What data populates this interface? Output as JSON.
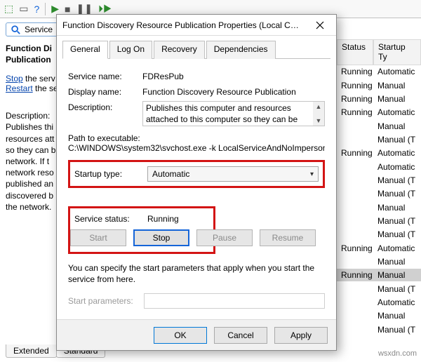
{
  "bg": {
    "search_placeholder": "Service",
    "left": {
      "title_line1": "Function Di",
      "title_line2": "Publication",
      "stop_link": "Stop",
      "stop_tail": " the serv",
      "restart_link": "Restart",
      "restart_tail": " the se",
      "desc_label": "Description:",
      "desc_body": "Publishes thi resources att so they can b network.  If t network reso published an discovered b the network."
    },
    "cols": {
      "status_hdr": "Status",
      "startup_hdr": "Startup Ty"
    },
    "rows": [
      {
        "status": "Running",
        "startup": "Automatic"
      },
      {
        "status": "Running",
        "startup": "Manual"
      },
      {
        "status": "Running",
        "startup": "Manual"
      },
      {
        "status": "Running",
        "startup": "Automatic"
      },
      {
        "status": "",
        "startup": "Manual"
      },
      {
        "status": "",
        "startup": "Manual (T"
      },
      {
        "status": "Running",
        "startup": "Automatic"
      },
      {
        "status": "",
        "startup": "Automatic"
      },
      {
        "status": "",
        "startup": "Manual (T"
      },
      {
        "status": "",
        "startup": "Manual (T"
      },
      {
        "status": "",
        "startup": "Manual"
      },
      {
        "status": "",
        "startup": "Manual (T"
      },
      {
        "status": "",
        "startup": "Manual (T"
      },
      {
        "status": "Running",
        "startup": "Automatic"
      },
      {
        "status": "",
        "startup": "Manual"
      },
      {
        "status": "Running",
        "startup": "Manual",
        "selected": true
      },
      {
        "status": "",
        "startup": "Manual (T"
      },
      {
        "status": "",
        "startup": "Automatic"
      },
      {
        "status": "",
        "startup": "Manual"
      },
      {
        "status": "",
        "startup": "Manual (T"
      }
    ],
    "tab_extended": "Extended",
    "tab_standard": "Standard"
  },
  "dialog": {
    "title": "Function Discovery Resource Publication Properties (Local Comput...",
    "tabs": {
      "general": "General",
      "logon": "Log On",
      "recovery": "Recovery",
      "dependencies": "Dependencies"
    },
    "service_name_lbl": "Service name:",
    "service_name": "FDResPub",
    "display_name_lbl": "Display name:",
    "display_name": "Function Discovery Resource Publication",
    "description_lbl": "Description:",
    "description": "Publishes this computer and resources attached to this computer so they can be discovered over the",
    "path_lbl": "Path to executable:",
    "path": "C:\\WINDOWS\\system32\\svchost.exe -k LocalServiceAndNoImpersonation",
    "startup_lbl": "Startup type:",
    "startup_value": "Automatic",
    "status_lbl": "Service status:",
    "status_value": "Running",
    "btn_start": "Start",
    "btn_stop": "Stop",
    "btn_pause": "Pause",
    "btn_resume": "Resume",
    "hint": "You can specify the start parameters that apply when you start the service from here.",
    "params_lbl": "Start parameters:",
    "params_value": "",
    "ok": "OK",
    "cancel": "Cancel",
    "apply": "Apply"
  },
  "watermark": "wsxdn.com"
}
